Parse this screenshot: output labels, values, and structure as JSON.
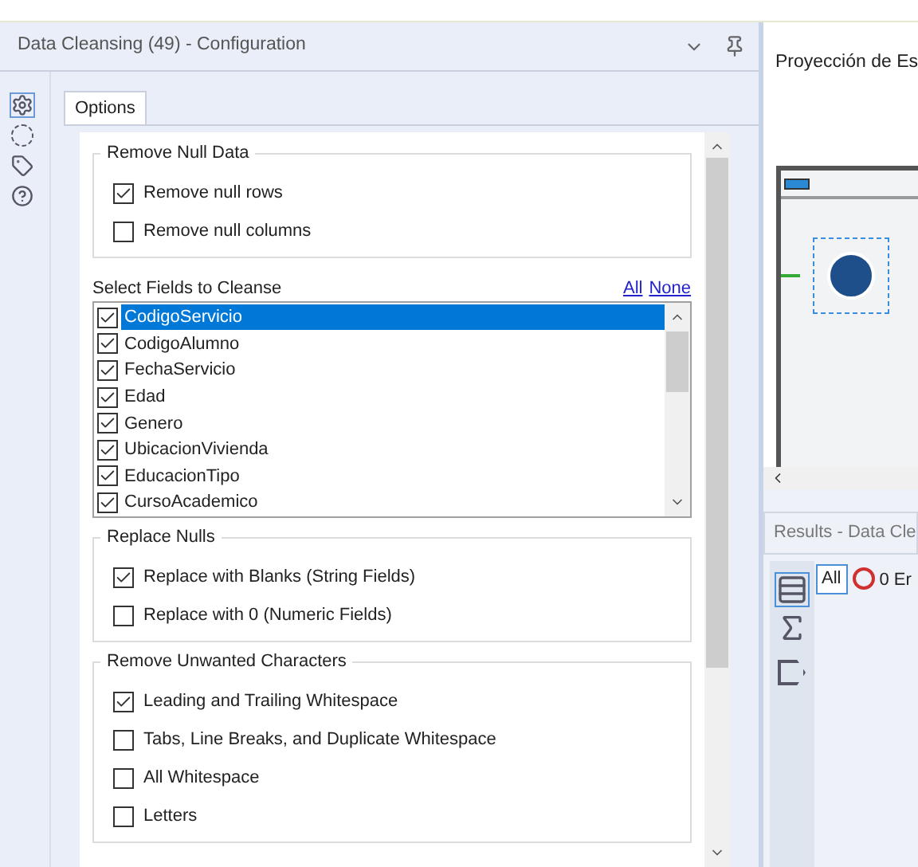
{
  "config": {
    "title": "Data Cleansing (49) - Configuration",
    "tabs": [
      {
        "label": "Options",
        "selected": true
      }
    ],
    "sections": [
      {
        "kind": "checks",
        "title": "Remove Null Data",
        "options": [
          {
            "label": "Remove null rows",
            "checked": true
          },
          {
            "label": "Remove null columns",
            "checked": false
          }
        ]
      },
      {
        "kind": "fields",
        "title": "Select Fields to Cleanse",
        "links": [
          "All",
          "None"
        ],
        "items": [
          {
            "label": "CodigoServicio",
            "checked": true,
            "selected": true
          },
          {
            "label": "CodigoAlumno",
            "checked": true,
            "selected": false
          },
          {
            "label": "FechaServicio",
            "checked": true,
            "selected": false
          },
          {
            "label": "Edad",
            "checked": true,
            "selected": false
          },
          {
            "label": "Genero",
            "checked": true,
            "selected": false
          },
          {
            "label": "UbicacionVivienda",
            "checked": true,
            "selected": false
          },
          {
            "label": "EducacionTipo",
            "checked": true,
            "selected": false
          },
          {
            "label": "CursoAcademico",
            "checked": true,
            "selected": false
          }
        ]
      },
      {
        "kind": "checks",
        "title": "Replace Nulls",
        "options": [
          {
            "label": "Replace with Blanks (String Fields)",
            "checked": true
          },
          {
            "label": "Replace with 0 (Numeric Fields)",
            "checked": false
          }
        ]
      },
      {
        "kind": "checks",
        "title": "Remove Unwanted Characters",
        "options": [
          {
            "label": "Leading and Trailing Whitespace",
            "checked": true
          },
          {
            "label": "Tabs, Line Breaks, and Duplicate Whitespace",
            "checked": false
          },
          {
            "label": "All Whitespace",
            "checked": false
          },
          {
            "label": "Letters",
            "checked": false
          }
        ]
      }
    ]
  },
  "workflow": {
    "title": "Proyección de Es"
  },
  "results": {
    "title": "Results - Data Cle",
    "filter": "All",
    "errors": "0 Er"
  }
}
